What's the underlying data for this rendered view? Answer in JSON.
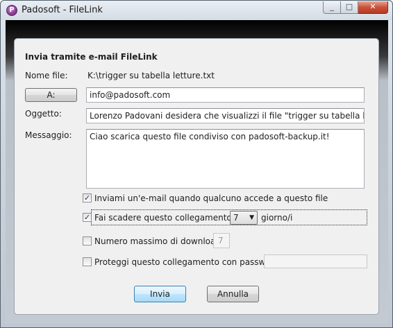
{
  "window": {
    "title": "Padosoft - FileLink",
    "icon": "padosoft-app-icon",
    "controls": {
      "minimize": "minimize-icon",
      "maximize": "maximize-icon",
      "close": "close-icon"
    }
  },
  "form": {
    "heading": "Invia tramite e-mail FileLink",
    "filename_label": "Nome file:",
    "filename_value": "K:\\trigger su tabella letture.txt",
    "to_button": "A:",
    "to_value": "info@padosoft.com",
    "subject_label": "Oggetto:",
    "subject_value": "Lorenzo Padovani desidera che visualizzi il file \"trigger su tabella letture.txt\"",
    "message_label": "Messaggio:",
    "message_value": "Ciao scarica questo file condiviso con padosoft-backup.it!"
  },
  "options": {
    "notify_label": "Inviami un'e-mail quando qualcuno accede a questo file",
    "notify_checked": true,
    "expire_label": "Fai scadere questo collegamento in:",
    "expire_checked": true,
    "expire_value": "7",
    "expire_unit": "giorno/i",
    "maxdl_label": "Numero massimo di download:",
    "maxdl_checked": false,
    "maxdl_value": "7",
    "password_label": "Proteggi questo collegamento con password:",
    "password_checked": false,
    "password_value": ""
  },
  "buttons": {
    "send": "Invia",
    "cancel": "Annulla"
  }
}
